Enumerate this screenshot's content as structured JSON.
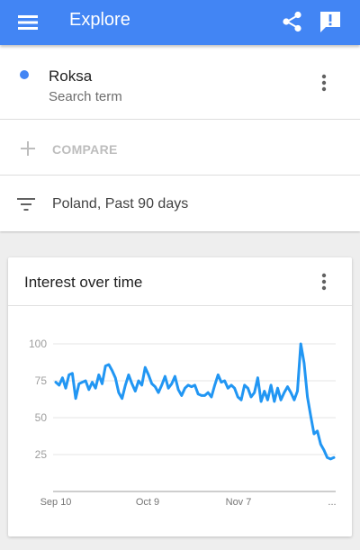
{
  "appbar": {
    "title": "Explore",
    "menu_icon": "hamburger-menu-icon",
    "share_icon": "share-icon",
    "feedback_icon": "feedback-icon",
    "color": "#4285f4"
  },
  "search_term": {
    "name": "Roksa",
    "subtitle": "Search term",
    "dot_color": "#4285f4"
  },
  "compare": {
    "label": "COMPARE"
  },
  "filter": {
    "label": "Poland, Past 90 days"
  },
  "card": {
    "title": "Interest over time"
  },
  "chart_data": {
    "type": "line",
    "title": "Interest over time",
    "xlabel": "",
    "ylabel": "",
    "y_ticks": [
      100,
      75,
      50,
      25
    ],
    "x_ticks": [
      "Sep 10",
      "Oct 9",
      "Nov 7",
      "..."
    ],
    "ylim": [
      0,
      100
    ],
    "grid": true,
    "series": [
      {
        "color": "#2196f3",
        "values": [
          74,
          72,
          77,
          70,
          79,
          80,
          63,
          73,
          74,
          75,
          69,
          74,
          70,
          79,
          73,
          85,
          86,
          82,
          77,
          67,
          63,
          72,
          79,
          73,
          68,
          75,
          72,
          84,
          79,
          73,
          71,
          67,
          72,
          78,
          70,
          73,
          78,
          69,
          65,
          70,
          72,
          71,
          72,
          66,
          65,
          65,
          67,
          64,
          72,
          79,
          74,
          75,
          70,
          72,
          70,
          64,
          62,
          72,
          70,
          64,
          67,
          77,
          61,
          68,
          62,
          72,
          61,
          70,
          62,
          67,
          71,
          67,
          62,
          68,
          100,
          87,
          64,
          51,
          39,
          41,
          32,
          28,
          23,
          22,
          23
        ]
      }
    ]
  }
}
